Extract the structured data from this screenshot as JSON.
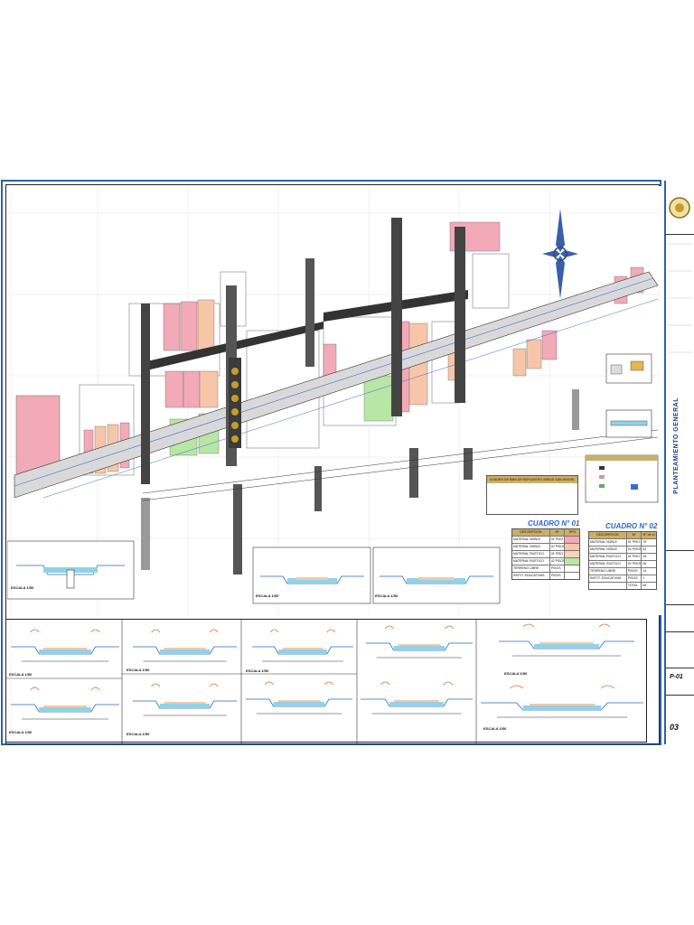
{
  "sheet": {
    "title": "PLANTEAMIENTO GENERAL",
    "sheet_code": "03",
    "sheet_prefix": "P-01"
  },
  "cuadro_bm": {
    "title": "CUADRO DE BMS DE REPLANTEO AREAS SAN MIGUEL"
  },
  "cuadro_01": {
    "title": "CUADRO N° 01",
    "headers": [
      "DESCRIPCION",
      "M²",
      "TIPO"
    ],
    "rows": [
      {
        "desc": "MATERIAL NOBLE",
        "m2": "01 PISO",
        "color": "#f2a9b8"
      },
      {
        "desc": "MATERIAL NOBLE",
        "m2": "02 PISOS",
        "color": "#f7c6a8"
      },
      {
        "desc": "MATERIAL RUSTICO",
        "m2": "01 PISO",
        "color": "#f7d6b8"
      },
      {
        "desc": "MATERIAL RUSTICO",
        "m2": "02 PISOS",
        "color": "#b8e6a4"
      },
      {
        "desc": "TERRENO LIBRE",
        "m2": "PISOS",
        "color": "#ffffff"
      },
      {
        "desc": "INSTIT. EDUCATIVAS",
        "m2": "PISOS",
        "color": "#ffffff"
      }
    ]
  },
  "cuadro_02": {
    "title": "CUADRO N° 02",
    "headers": [
      "DESCRIPCION",
      "M²",
      "N° de vi"
    ],
    "rows": [
      {
        "desc": "MATERIAL NOBLE",
        "m2": "01 PISO",
        "n": "75"
      },
      {
        "desc": "MATERIAL NOBLE",
        "m2": "02 PISOS",
        "n": "52"
      },
      {
        "desc": "MATERIAL RUSTICO",
        "m2": "01 PISO",
        "n": "28"
      },
      {
        "desc": "MATERIAL RUSTICO",
        "m2": "02 PISOS",
        "n": "06"
      },
      {
        "desc": "TERRENO LIBRE",
        "m2": "PISOS",
        "n": "14"
      },
      {
        "desc": "INSTIT. EDUCATIVAS",
        "m2": "PISOS",
        "n": "1"
      }
    ],
    "total_label": "TOTAL",
    "total": "##"
  },
  "escalas": [
    "ESCALA 1/50",
    "ESCALA 1/50",
    "ESCALA 1/50",
    "ESCALA 1/50",
    "ESCALA 1/50",
    "ESCALA 1/50",
    "ESCALA 1/50",
    "ESCALA 1/50",
    "ESCALA 1/50",
    "ESCALA 1/50",
    "ESCALA 1/50"
  ],
  "colors": {
    "frame": "#2b5fb3",
    "road": "#333333",
    "pink": "#f2a9b8",
    "salmon": "#f7c6a8",
    "green": "#b8e6a4",
    "water": "#8fd3e6"
  }
}
